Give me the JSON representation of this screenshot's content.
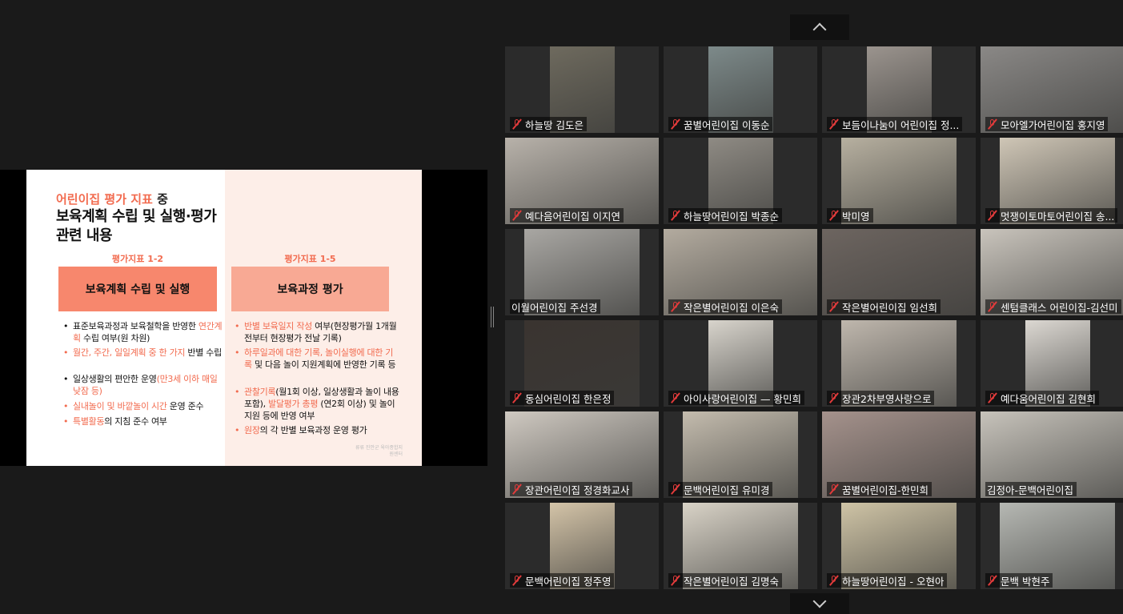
{
  "slide": {
    "subtitle_red": "어린이집 평가 지표",
    "subtitle_black": " 중",
    "title": "보육계획 수립 및 실행·평가 관련 내용",
    "left": {
      "label": "평가지표 1-2",
      "box": "보육계획 수립 및 실행",
      "b1_a": "표준보육과정과 보육철학을 반영한 ",
      "b1_red": "연간계획",
      "b1_b": " 수립 여부(원 차원)",
      "b2": "월간, 주간, 일일계획 중 한 가지",
      "b2_b": " 반별 수립",
      "b3_a": "일상생활의 편안한 운영",
      "b3_red": "(만3세 이하 매일 낮잠 등)",
      "b4_red": "실내놀이 및 바깥놀이 시간",
      "b4_b": " 운영 준수",
      "b5_red": "특별활동",
      "b5_b": "의 지침 준수 여부"
    },
    "right": {
      "label": "평가지표 1-5",
      "box": "보육과정 평가",
      "b1_red": "반별 보육일지 작성",
      "b1_b": " 여부(현장평가월 1개월 전부터 현장평가 전날 기록)",
      "b2_red": "하루일과에 대한 기록, 놀이실행에 대한 기록",
      "b2_b": " 및 다음 놀이 지원계획에 반영한 기록 등",
      "b3_red": "관찰기록",
      "b3_a": "(월1회 이상, 일상생활과 놀이 내용 포함), ",
      "b3_red2": "발달평가 총평",
      "b3_b": " (연2회 이상) 및 놀이지원 등에 반영 여부",
      "b4_red": "원장",
      "b4_b": "의 각 반별 보육과정 운영 평가"
    },
    "footnote": "류류 진안군 육아종합지원센터"
  },
  "participants": [
    "하늘땅 김도은",
    "꿈별어린이집 이동순",
    "보듬이나눔이 어린이집 정...",
    "모아엘가어린이집 홍지영",
    "예다음어린이집 이지연",
    "하늘땅어린이집 박종순",
    "박미영",
    "멋쟁이토마토어린이집 송...",
    "이월어린이집 주선경",
    "작은별어린이집 이은숙",
    "작은별어린이집 임선희",
    "센텀클래스 어린이집-김선미",
    "동심어린이집 한은정",
    "아이사랑어린이집 — 황민희",
    "장관2차부영사랑으로",
    "예다움어린이집 김현희",
    "장관어린이집 정경화교사",
    "문백어린이집 유미경",
    "꿈별어린이집-한민희",
    "김정아-문백어린이집",
    "문백어린이집 정주영",
    "작은별어린이집 김명숙",
    "하늘땅어린이집 - 오현아",
    "문백 박현주"
  ],
  "tile_colors": [
    "#6e6a5e",
    "#7d8a8a",
    "#9b948e",
    "#8a8886",
    "#b8b2aa",
    "#8f8b84",
    "#b7b0a0",
    "#cfc6b6",
    "#a9a7a3",
    "#b3ab9f",
    "#6d6560",
    "#c9c4bc",
    "#3a3430",
    "#d8d4cc",
    "#bfb7ad",
    "#dcd8d2",
    "#cfc9c1",
    "#c4bcae",
    "#a5928c",
    "#c7c3bb",
    "#d4c4a8",
    "#d9d3c7",
    "#cfc4a6",
    "#b6b8b3"
  ],
  "icons": {
    "nav_up": "chevron-up-icon",
    "nav_down": "chevron-down-icon",
    "mic_muted": "mic-muted-icon"
  }
}
